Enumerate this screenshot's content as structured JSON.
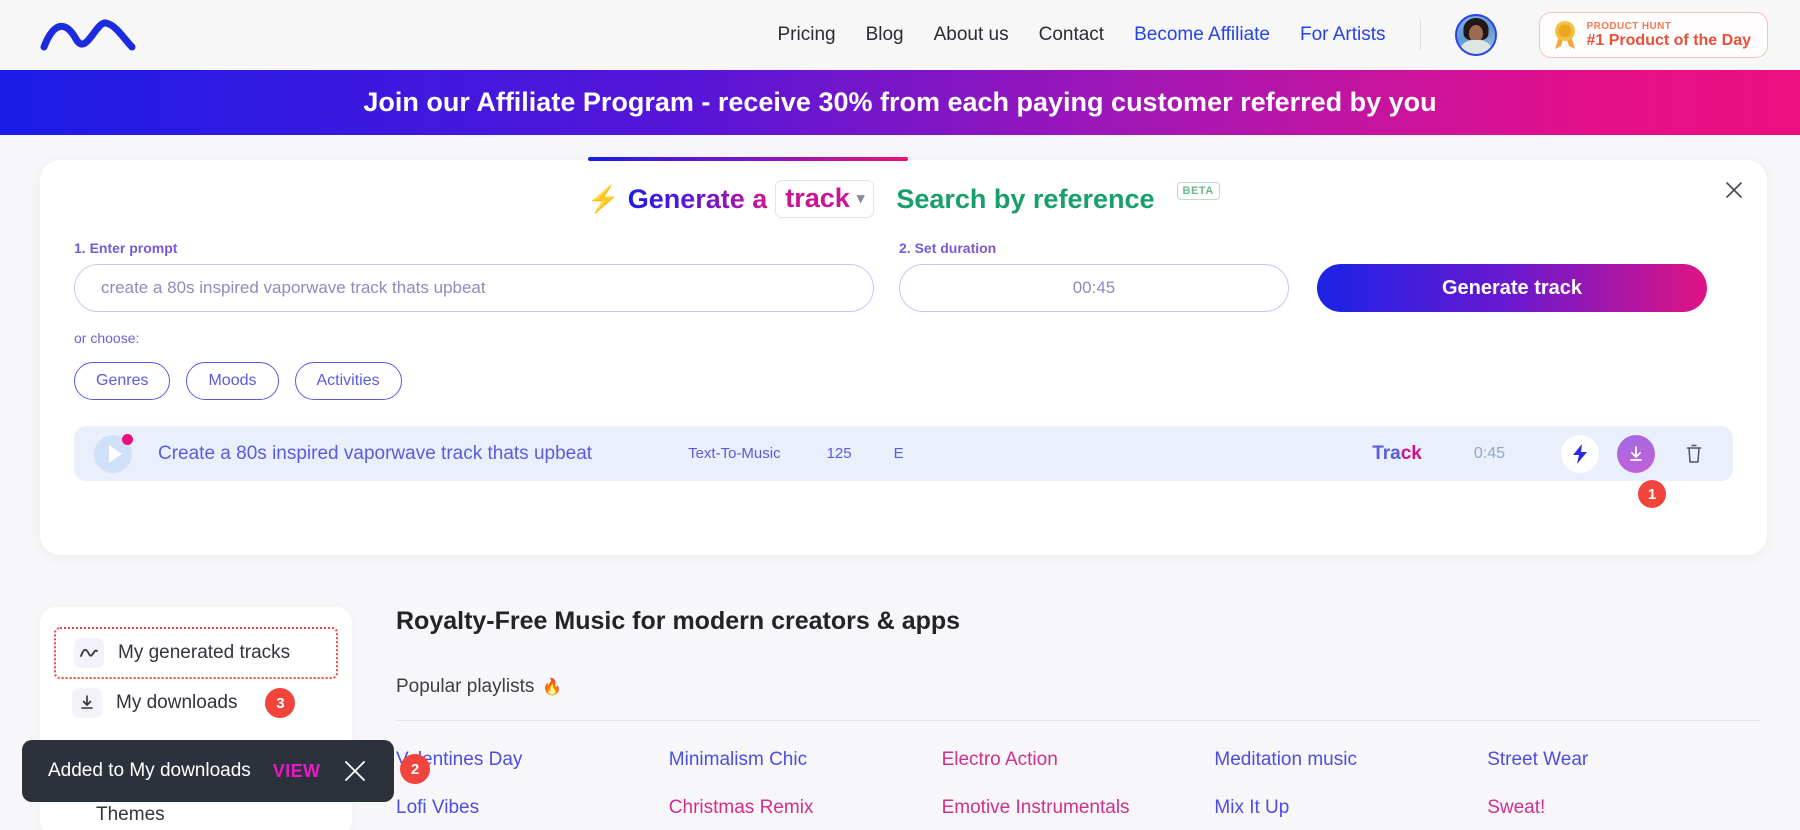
{
  "header": {
    "logo_icon": "wave-logo",
    "nav": [
      {
        "label": "Pricing",
        "accent": false
      },
      {
        "label": "Blog",
        "accent": false
      },
      {
        "label": "About us",
        "accent": false
      },
      {
        "label": "Contact",
        "accent": false
      },
      {
        "label": "Become Affiliate",
        "accent": true
      },
      {
        "label": "For Artists",
        "accent": true
      }
    ],
    "avatar_alt": "user-avatar",
    "product_hunt": {
      "top_label": "PRODUCT HUNT",
      "main_label": "#1 Product of the Day"
    }
  },
  "affiliate_banner": {
    "text": "Join our Affiliate Program - receive 30% from each paying customer referred by you"
  },
  "generate_card": {
    "tab_generate_prefix": "Generate a",
    "tab_generate_select": "track",
    "tab_search": "Search by reference",
    "beta_label": "BETA",
    "close_icon": "close-icon",
    "prompt": {
      "label": "1. Enter prompt",
      "placeholder": "create a 80s inspired vaporwave track thats upbeat",
      "value": ""
    },
    "duration": {
      "label": "2. Set duration",
      "value": "00:45"
    },
    "generate_button": "Generate track",
    "or_choose_label": "or choose:",
    "chips": [
      "Genres",
      "Moods",
      "Activities"
    ],
    "track_row": {
      "title": "Create a 80s inspired vaporwave track thats upbeat",
      "source": "Text-To-Music",
      "bpm": "125",
      "key": "E",
      "type_word1": "Tra",
      "type_word2": "ck",
      "duration": "0:45",
      "badge": "1"
    }
  },
  "sidebar": {
    "items": [
      {
        "label": "My generated tracks",
        "icon": "wave-icon",
        "badge": "",
        "highlighted": true
      },
      {
        "label": "My downloads",
        "icon": "download-icon",
        "badge": "3",
        "highlighted": false
      }
    ],
    "themes_label": "Themes"
  },
  "main": {
    "title": "Royalty-Free Music for modern creators & apps",
    "popular_label": "Popular playlists",
    "popular_emoji": "🔥",
    "playlists": [
      {
        "label": "Valentines Day",
        "color": "a"
      },
      {
        "label": "Minimalism Chic",
        "color": "a"
      },
      {
        "label": "Electro Action",
        "color": "b"
      },
      {
        "label": "Meditation music",
        "color": "a"
      },
      {
        "label": "Street Wear",
        "color": "a"
      },
      {
        "label": "Lofi Vibes",
        "color": "a"
      },
      {
        "label": "Christmas Remix",
        "color": "b"
      },
      {
        "label": "Emotive Instrumentals",
        "color": "b"
      },
      {
        "label": "Mix It Up",
        "color": "a"
      },
      {
        "label": "Sweat!",
        "color": "b"
      }
    ]
  },
  "toast": {
    "message": "Added to My downloads",
    "action": "VIEW",
    "close_icon": "close-icon",
    "badge": "2"
  },
  "colors": {
    "accent_blue": "#2643e8",
    "accent_pink": "#ec0f7f",
    "accent_green": "#19a06a",
    "badge_red": "#f0443c"
  }
}
